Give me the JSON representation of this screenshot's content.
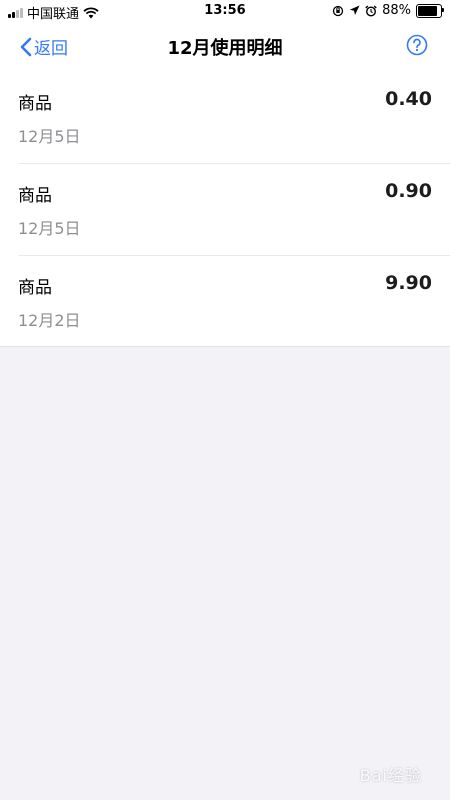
{
  "status_bar": {
    "carrier": "中国联通",
    "time": "13:56",
    "battery_percent": "88%",
    "battery_level": 0.88
  },
  "nav": {
    "back_label": "返回",
    "title": "12月使用明细"
  },
  "items": [
    {
      "name": "商品",
      "date": "12月5日",
      "amount": "0.40"
    },
    {
      "name": "商品",
      "date": "12月5日",
      "amount": "0.90"
    },
    {
      "name": "商品",
      "date": "12月2日",
      "amount": "9.90"
    }
  ],
  "watermark": "Bai经验",
  "colors": {
    "accent": "#3478f6",
    "secondary_text": "#8e8e93",
    "background": "#f2f2f7"
  },
  "icons": [
    "signal-icon",
    "wifi-icon",
    "orientation-lock-icon",
    "location-icon",
    "alarm-icon",
    "battery-icon",
    "chevron-left-icon",
    "help-icon"
  ]
}
